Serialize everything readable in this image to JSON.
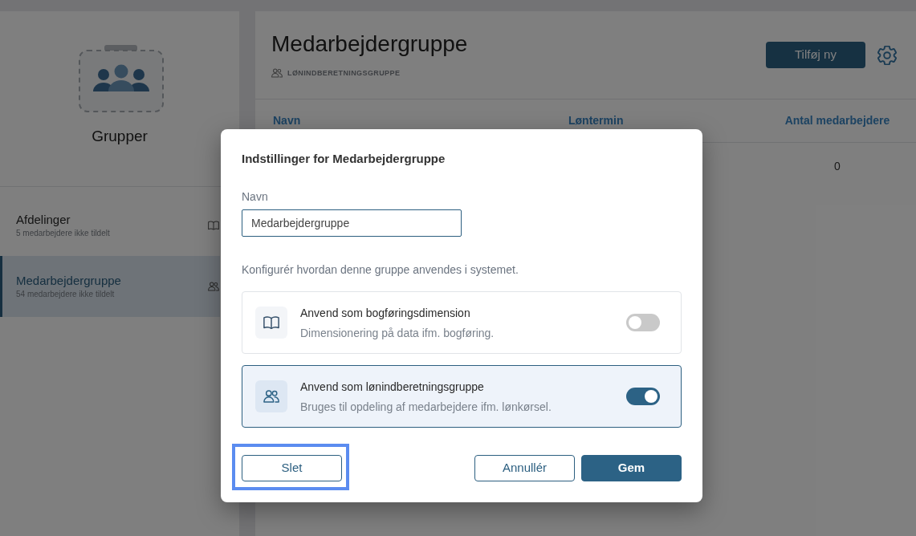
{
  "sidebar": {
    "title": "Grupper",
    "items": [
      {
        "label": "Afdelinger",
        "subtitle": "5 medarbejdere ikke tildelt",
        "kind": "book",
        "selected": false
      },
      {
        "label": "Medarbejdergruppe",
        "subtitle": "54 medarbejdere ikke tildelt",
        "kind": "people",
        "selected": true
      }
    ]
  },
  "header": {
    "title": "Medarbejdergruppe",
    "tag": "LØNINDBERETNINGSGRUPPE",
    "add_button": "Tilføj ny"
  },
  "table": {
    "columns": [
      "Navn",
      "Løntermin",
      "Antal medarbejdere"
    ],
    "rows": [
      {
        "employee_count": "0"
      }
    ]
  },
  "dialog": {
    "title": "Indstillinger for Medarbejdergruppe",
    "name_field": {
      "label": "Navn",
      "value": "Medarbejdergruppe"
    },
    "description": "Konfigurér hvordan denne gruppe anvendes i systemet.",
    "options": [
      {
        "kind": "book",
        "title": "Anvend som bogføringsdimension",
        "description": "Dimensionering på data ifm. bogføring.",
        "on": false
      },
      {
        "kind": "people",
        "title": "Anvend som lønindberetningsgruppe",
        "description": "Bruges til opdeling af medarbejdere ifm. lønkørsel.",
        "on": true
      }
    ],
    "buttons": [
      {
        "label": "Slet",
        "kind": "secondary",
        "focused": true
      },
      {
        "label": "Annullér",
        "kind": "secondary",
        "focused": false
      },
      {
        "label": "Gem",
        "kind": "primary",
        "focused": false
      }
    ]
  }
}
